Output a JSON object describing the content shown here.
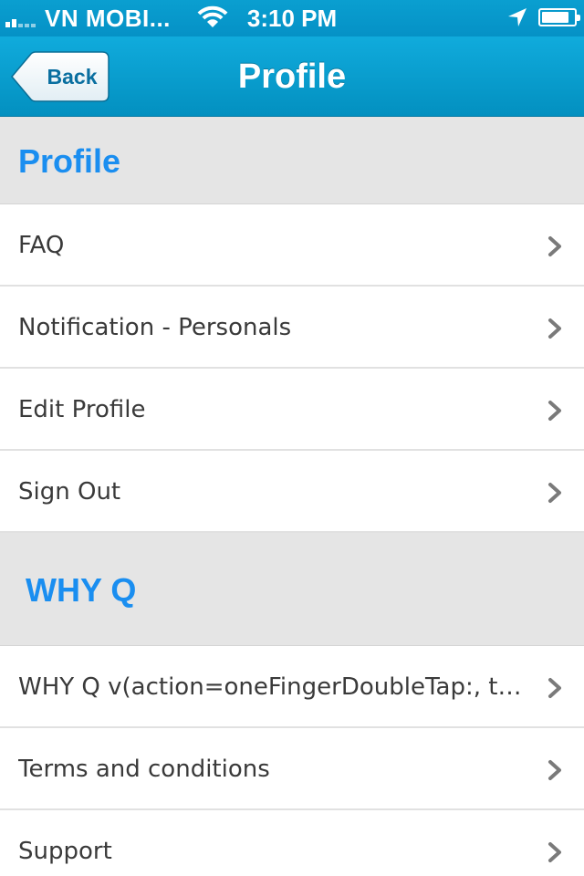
{
  "status_bar": {
    "carrier": "VN MOBI...",
    "time": "3:10 PM",
    "battery_level": 0.85
  },
  "nav_bar": {
    "back_label": "Back",
    "title": "Profile"
  },
  "sections": [
    {
      "header": "Profile",
      "items": [
        {
          "label": "FAQ"
        },
        {
          "label": "Notification - Personals"
        },
        {
          "label": "Edit Profile"
        },
        {
          "label": "Sign Out"
        }
      ]
    },
    {
      "header": "WHY Q",
      "items": [
        {
          "label": "WHY Q v(action=oneFingerDoubleTap:, ta…"
        },
        {
          "label": "Terms and conditions"
        },
        {
          "label": "Support"
        }
      ]
    }
  ],
  "colors": {
    "bar_blue": "#0a9fd0",
    "section_header_text": "#1a8ef0",
    "section_header_bg": "#e5e5e5",
    "row_text": "#3a3a3a",
    "chevron": "#7a7a7a"
  }
}
